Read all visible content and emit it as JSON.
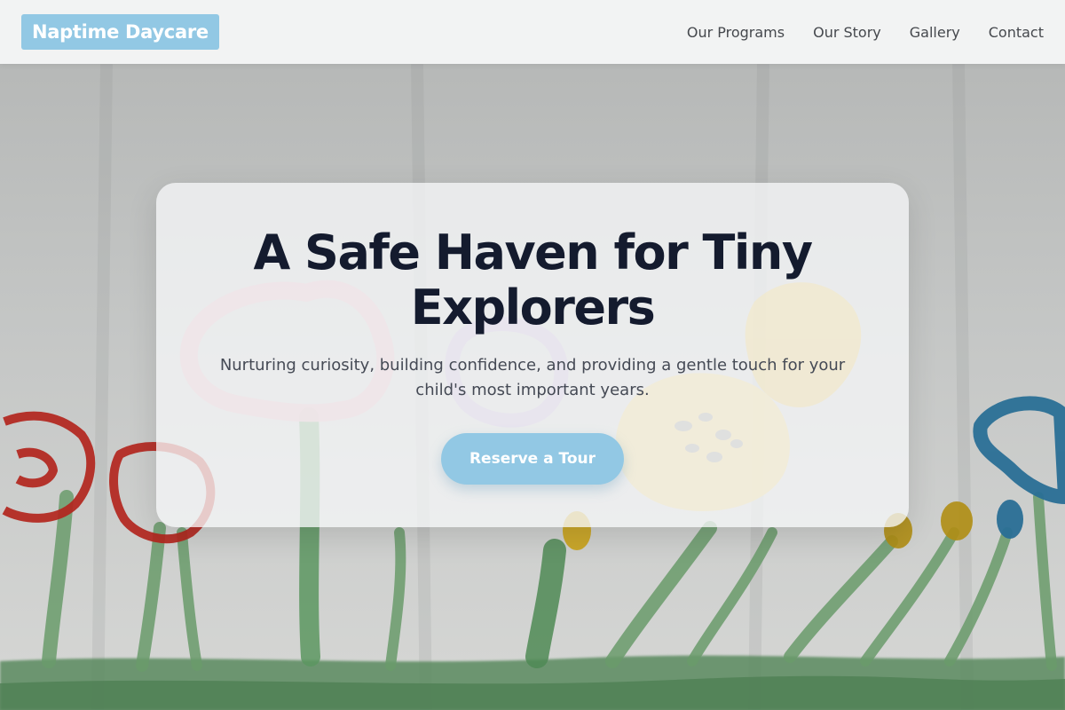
{
  "header": {
    "logo_text": "Naptime Daycare",
    "nav": [
      {
        "label": "Our Programs"
      },
      {
        "label": "Our Story"
      },
      {
        "label": "Gallery"
      },
      {
        "label": "Contact"
      }
    ]
  },
  "hero": {
    "title": "A Safe Haven for Tiny Explorers",
    "subtitle": "Nurturing curiosity, building confidence, and providing a gentle touch for your child's most important years.",
    "cta_label": "Reserve a Tour",
    "background_image": "children's watercolor painting of flowers"
  },
  "colors": {
    "accent": "#92c8e4",
    "title": "#141b2e",
    "subtitle": "#454a55",
    "nav_text": "#45484d",
    "navbar_bg": "#f4f5f5"
  }
}
